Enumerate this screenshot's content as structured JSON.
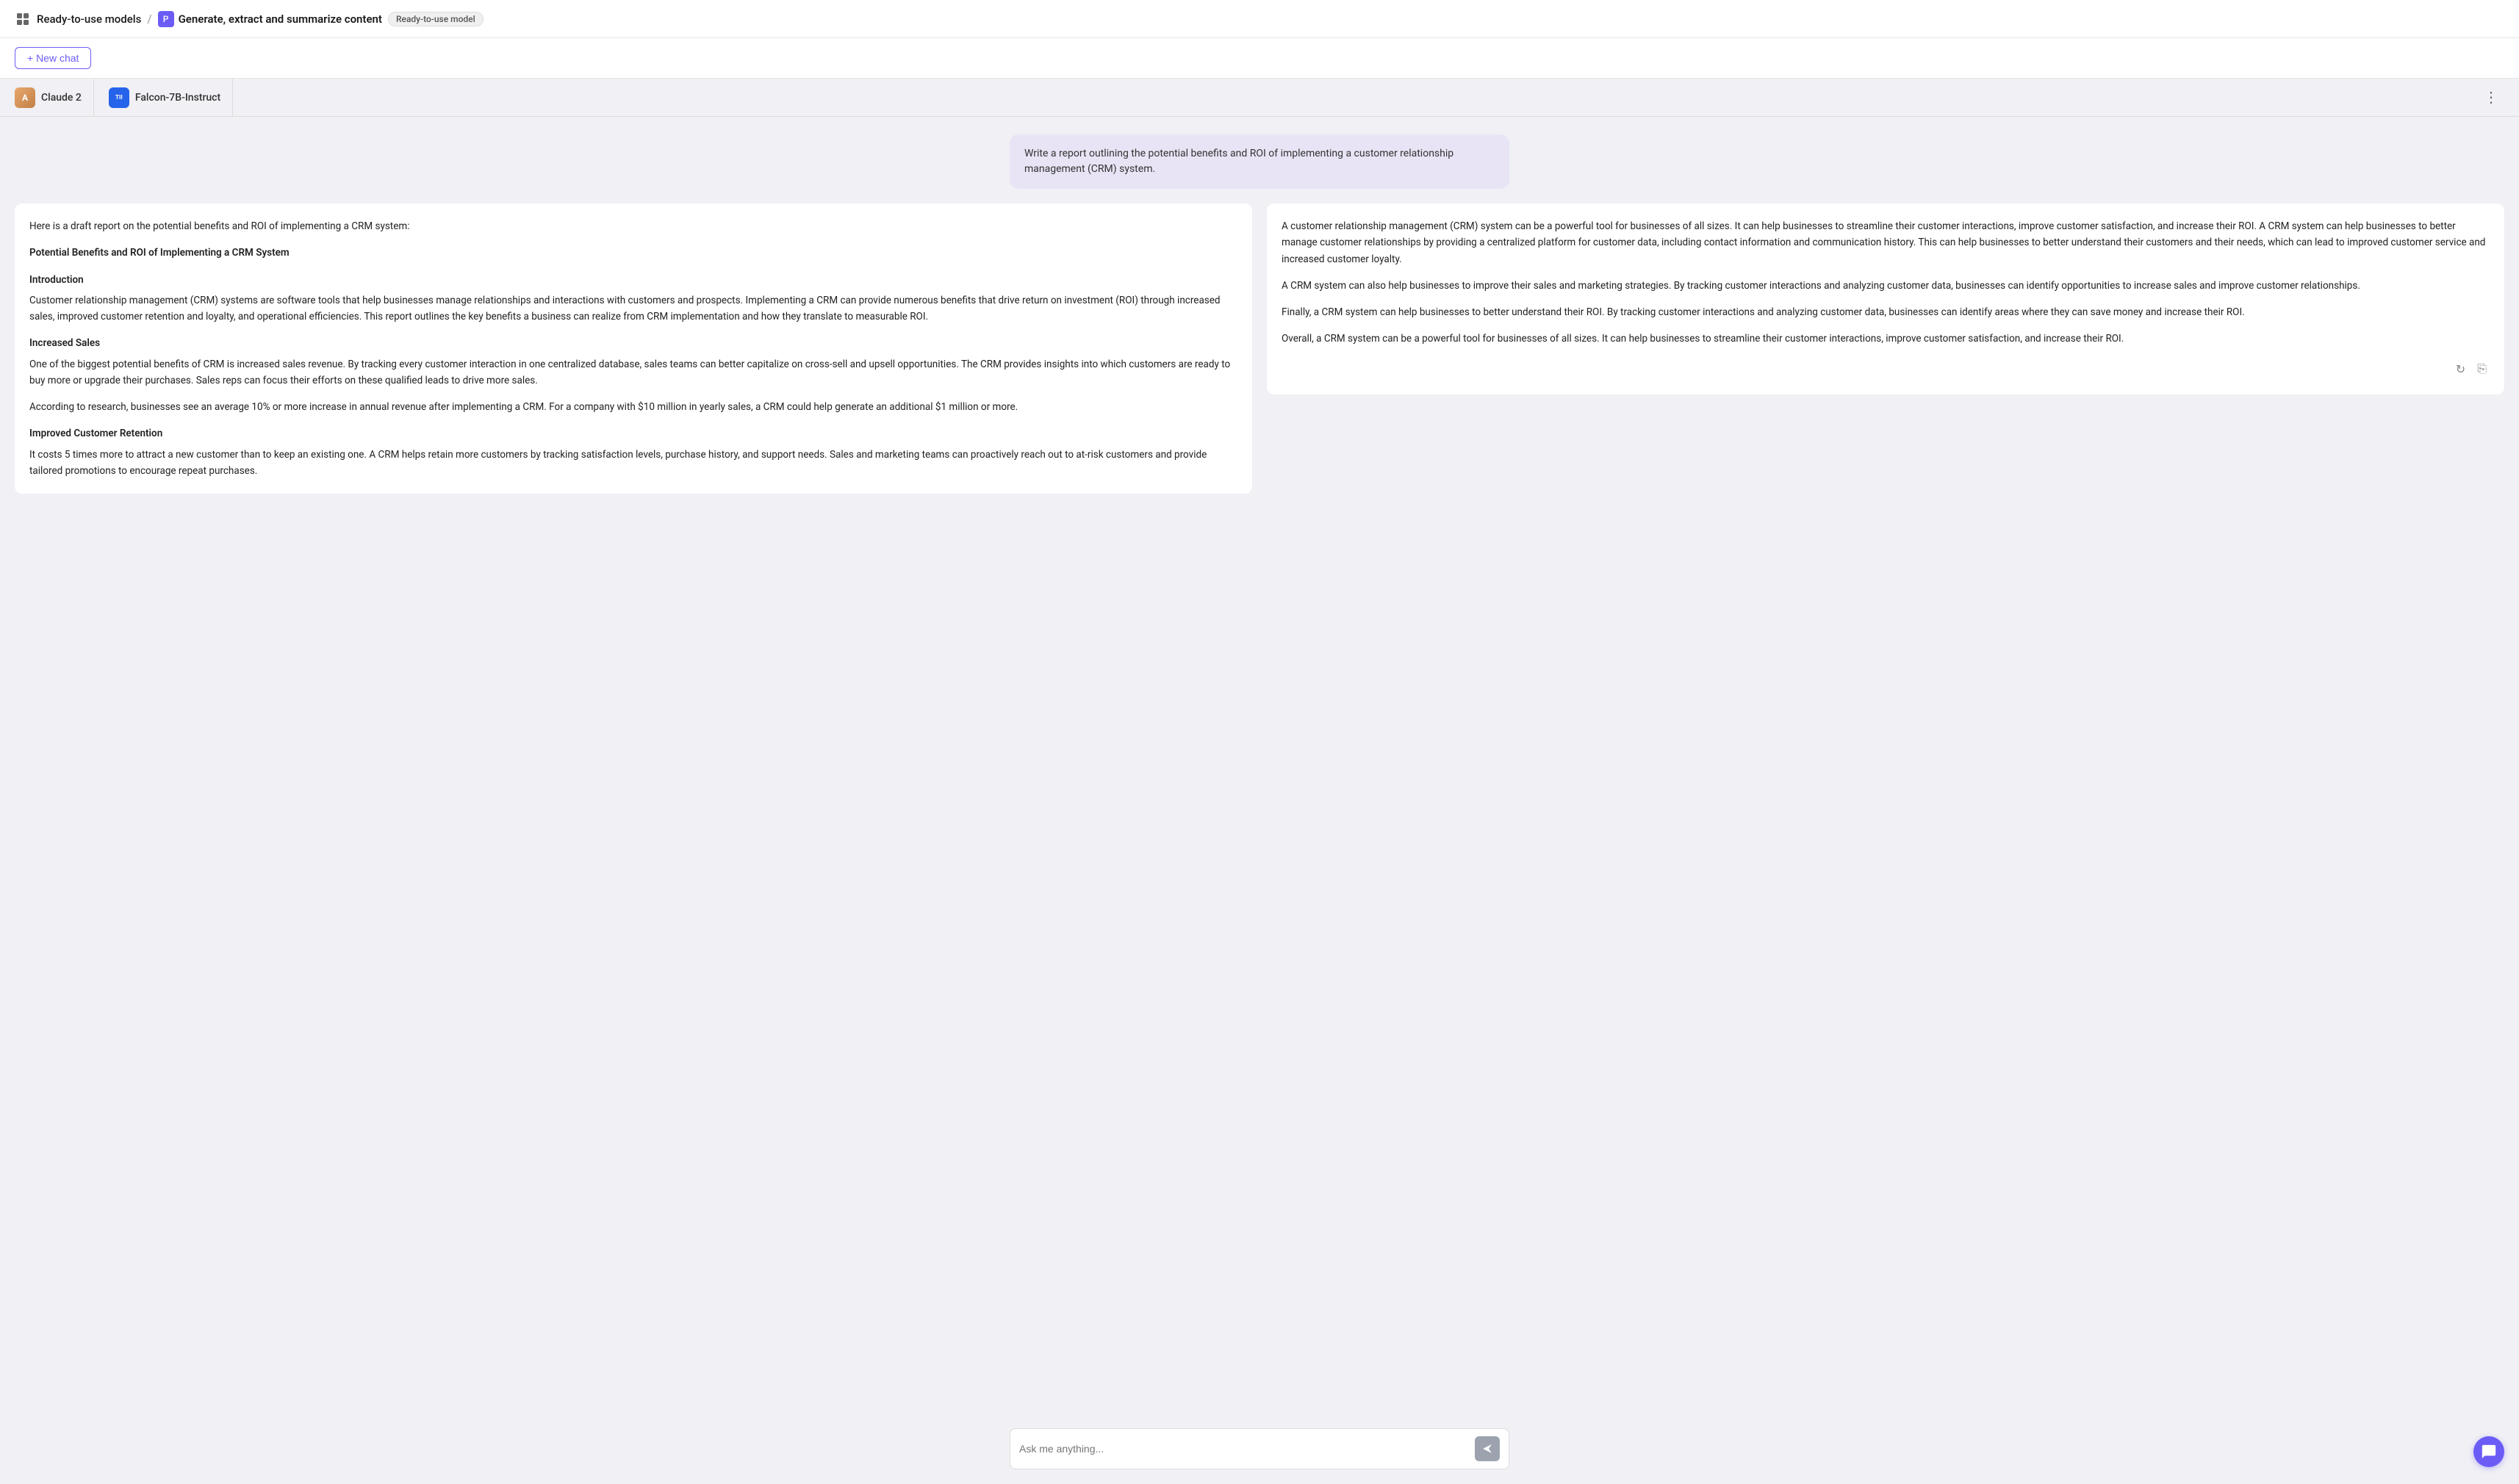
{
  "header": {
    "breadcrumb1": "Ready-to-use models",
    "separator": "/",
    "title": "Generate, extract and summarize content",
    "badge": "Ready-to-use model"
  },
  "toolbar": {
    "new_chat_label": "+ New chat"
  },
  "models": {
    "left": {
      "name": "Claude 2",
      "avatar_letter": "A"
    },
    "right": {
      "name": "Falcon-7B-Instruct",
      "avatar_letter": "TII"
    }
  },
  "user_message": "Write a report outlining the potential benefits and ROI of implementing a customer relationship management (CRM) system.",
  "response_left": {
    "intro": "Here is a draft report on the potential benefits and ROI of implementing a CRM system:",
    "title": "Potential Benefits and ROI of Implementing a CRM System",
    "intro_heading": "Introduction",
    "intro_body": "Customer relationship management (CRM) systems are software tools that help businesses manage relationships and interactions with customers and prospects. Implementing a CRM can provide numerous benefits that drive return on investment (ROI) through increased sales, improved customer retention and loyalty, and operational efficiencies. This report outlines the key benefits a business can realize from CRM implementation and how they translate to measurable ROI.",
    "sales_heading": "Increased Sales",
    "sales_body": "One of the biggest potential benefits of CRM is increased sales revenue. By tracking every customer interaction in one centralized database, sales teams can better capitalize on cross-sell and upsell opportunities. The CRM provides insights into which customers are ready to buy more or upgrade their purchases. Sales reps can focus their efforts on these qualified leads to drive more sales.",
    "sales_stats": "According to research, businesses see an average 10% or more increase in annual revenue after implementing a CRM. For a company with $10 million in yearly sales, a CRM could help generate an additional $1 million or more.",
    "retention_heading": "Improved Customer Retention",
    "retention_body": "It costs 5 times more to attract a new customer than to keep an existing one. A CRM helps retain more customers by tracking satisfaction levels, purchase history, and support needs. Sales and marketing teams can proactively reach out to at-risk customers and provide tailored promotions to encourage repeat purchases."
  },
  "response_right": {
    "para1": "A customer relationship management (CRM) system can be a powerful tool for businesses of all sizes. It can help businesses to streamline their customer interactions, improve customer satisfaction, and increase their ROI. A CRM system can help businesses to better manage customer relationships by providing a centralized platform for customer data, including contact information and communication history. This can help businesses to better understand their customers and their needs, which can lead to improved customer service and increased customer loyalty.",
    "para2": "A CRM system can also help businesses to improve their sales and marketing strategies. By tracking customer interactions and analyzing customer data, businesses can identify opportunities to increase sales and improve customer relationships.",
    "para3": "Finally, a CRM system can help businesses to better understand their ROI. By tracking customer interactions and analyzing customer data, businesses can identify areas where they can save money and increase their ROI.",
    "para4": "Overall, a CRM system can be a powerful tool for businesses of all sizes. It can help businesses to streamline their customer interactions, improve customer satisfaction, and increase their ROI."
  },
  "input": {
    "placeholder": "Ask me anything..."
  },
  "icons": {
    "send": "▶",
    "refresh": "↻",
    "copy": "⎘",
    "more": "⋮",
    "chat_bubble": "💬"
  }
}
